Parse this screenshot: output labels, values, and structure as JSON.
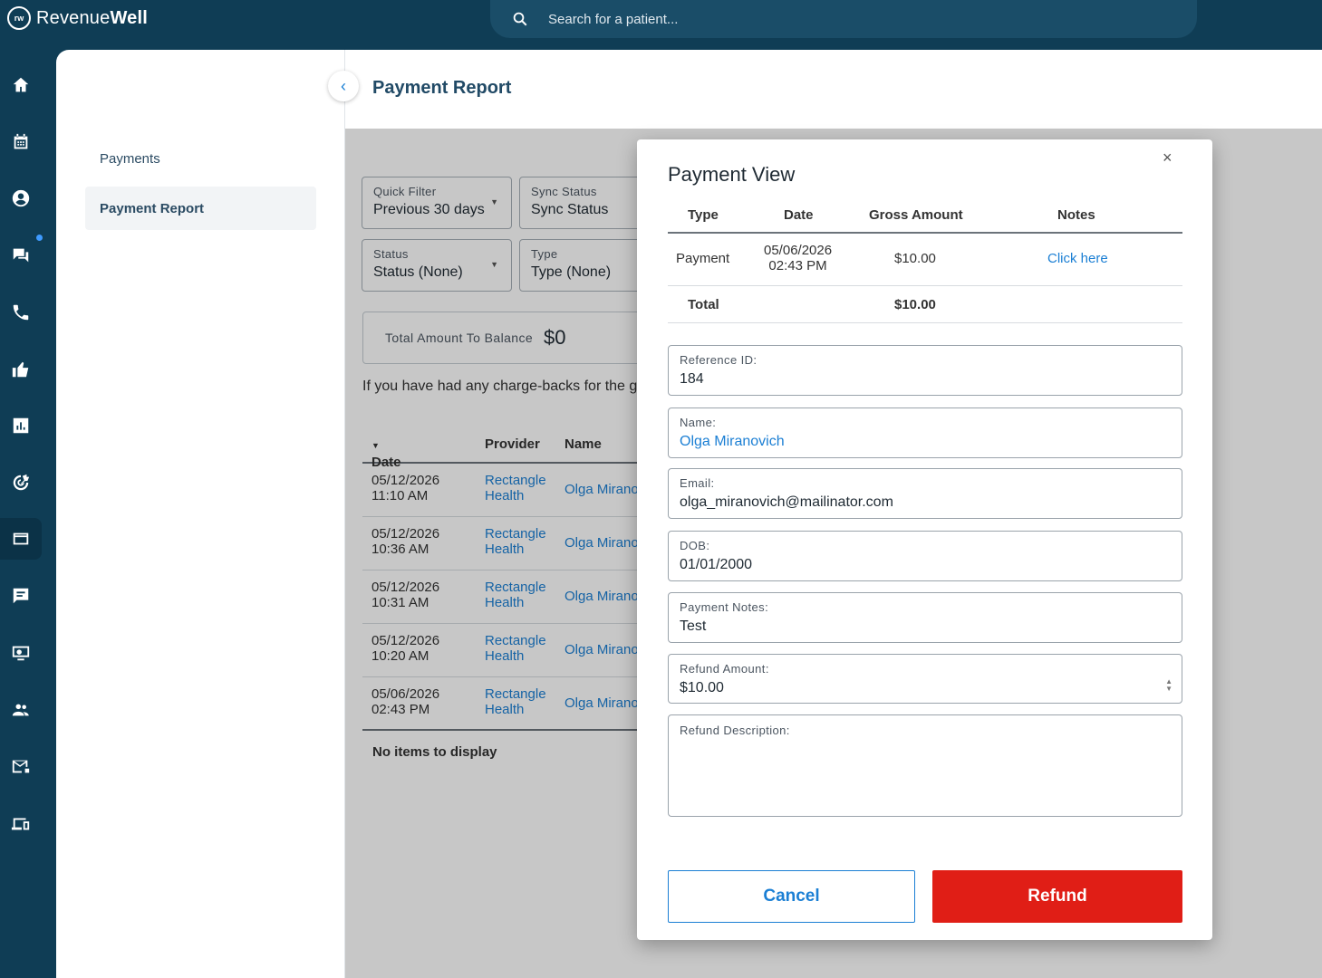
{
  "app": {
    "logo_mark": "rw",
    "logo_light": "Revenue",
    "logo_bold": "Well"
  },
  "search": {
    "placeholder": "Search for a patient..."
  },
  "rail_icons": [
    "home-icon",
    "calendar-icon",
    "patient-icon",
    "chat-icon",
    "phone-icon",
    "thumbs-up-icon",
    "chart-icon",
    "target-icon",
    "payment-card-icon",
    "message-icon",
    "monitor-icon",
    "people-icon",
    "mail-icon",
    "devices-icon"
  ],
  "sidebar": {
    "items": [
      {
        "label": "Payments"
      },
      {
        "label": "Payment Report"
      }
    ]
  },
  "header": {
    "title": "Payment Report"
  },
  "filters": {
    "quick": {
      "label": "Quick Filter",
      "value": "Previous 30 days"
    },
    "sync": {
      "label": "Sync Status",
      "value": "Sync Status"
    },
    "status": {
      "label": "Status",
      "value": "Status (None)"
    },
    "type": {
      "label": "Type",
      "value": "Type (None)"
    }
  },
  "balance": {
    "label": "Total Amount To Balance",
    "value": "$0"
  },
  "chargeback_note": "If you have had any charge-backs for the giv",
  "table": {
    "headers": {
      "date": "Date",
      "provider": "Provider",
      "name": "Name"
    },
    "rows": [
      {
        "date": "05/12/2026",
        "time": "11:10 AM",
        "provider1": "Rectangle",
        "provider2": "Health",
        "name": "Olga Mirano"
      },
      {
        "date": "05/12/2026",
        "time": "10:36 AM",
        "provider1": "Rectangle",
        "provider2": "Health",
        "name": "Olga Mirano"
      },
      {
        "date": "05/12/2026",
        "time": "10:31 AM",
        "provider1": "Rectangle",
        "provider2": "Health",
        "name": "Olga Mirano"
      },
      {
        "date": "05/12/2026",
        "time": "10:20 AM",
        "provider1": "Rectangle",
        "provider2": "Health",
        "name": "Olga Mirano"
      },
      {
        "date": "05/06/2026",
        "time": "02:43 PM",
        "provider1": "Rectangle",
        "provider2": "Health",
        "name": "Olga Mirano"
      }
    ],
    "empty_text": "No items to display"
  },
  "modal": {
    "title": "Payment View",
    "close": "×",
    "columns": {
      "type": "Type",
      "date": "Date",
      "gross": "Gross Amount",
      "notes": "Notes"
    },
    "row": {
      "type": "Payment",
      "date": "05/06/2026",
      "time": "02:43 PM",
      "gross": "$10.00",
      "notes": "Click here"
    },
    "total": {
      "label": "Total",
      "amount": "$10.00"
    },
    "fields": {
      "reference": {
        "label": "Reference ID:",
        "value": "184"
      },
      "name": {
        "label": "Name:",
        "value": "Olga Miranovich"
      },
      "email": {
        "label": "Email:",
        "value": "olga_miranovich@mailinator.com"
      },
      "dob": {
        "label": "DOB:",
        "value": "01/01/2000"
      },
      "notes": {
        "label": "Payment Notes:",
        "value": "Test"
      },
      "refund_amount": {
        "label": "Refund Amount:",
        "value": "$10.00"
      },
      "refund_description": {
        "label": "Refund Description:",
        "value": ""
      }
    },
    "cancel_label": "Cancel",
    "refund_label": "Refund"
  },
  "colors": {
    "navy": "#0f3d55",
    "link": "#1b7fd4",
    "refund": "#e01e16"
  }
}
